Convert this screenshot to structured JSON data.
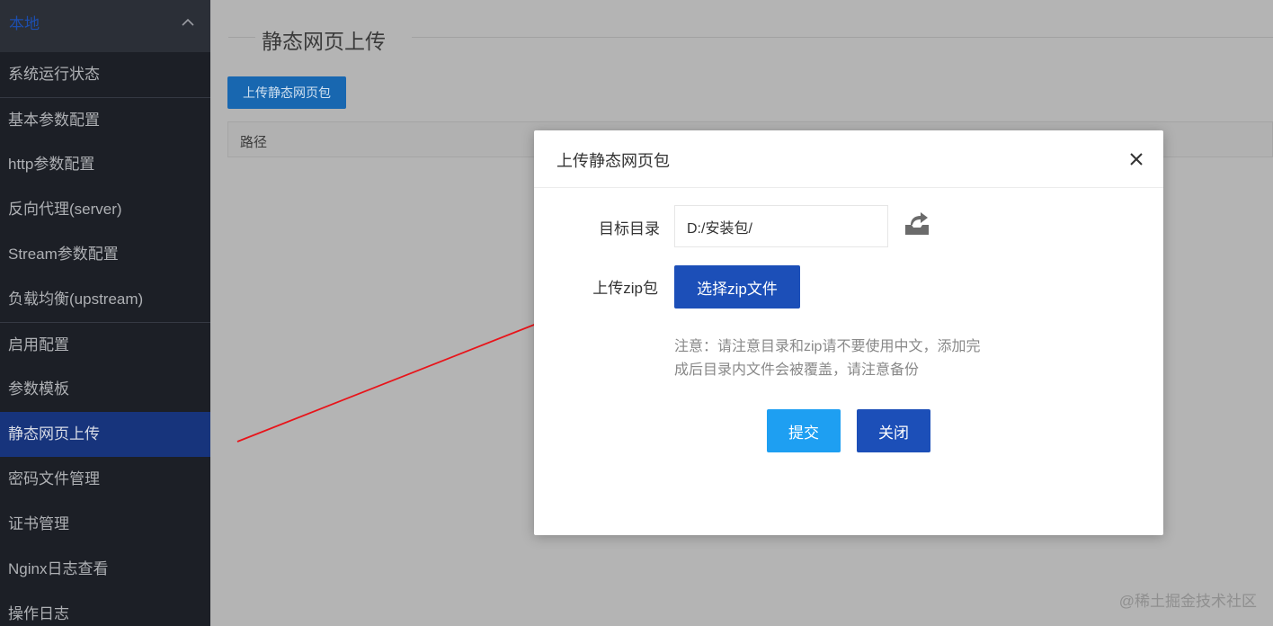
{
  "sidebar": {
    "group_title": "本地",
    "group_icon": "chevron-up-icon",
    "items": [
      {
        "label": "系统运行状态"
      },
      {
        "label": "基本参数配置"
      },
      {
        "label": "http参数配置"
      },
      {
        "label": "反向代理(server)"
      },
      {
        "label": "Stream参数配置"
      },
      {
        "label": "负载均衡(upstream)"
      },
      {
        "label": "启用配置"
      },
      {
        "label": "参数模板"
      },
      {
        "label": "静态网页上传",
        "active": true
      },
      {
        "label": "密码文件管理"
      },
      {
        "label": "证书管理"
      },
      {
        "label": "Nginx日志查看"
      },
      {
        "label": "操作日志"
      }
    ]
  },
  "main": {
    "page_title": "静态网页上传",
    "upload_button": "上传静态网页包",
    "table": {
      "columns": [
        "路径"
      ]
    }
  },
  "modal": {
    "title": "上传静态网页包",
    "close_icon": "close-icon",
    "target_dir_label": "目标目录",
    "target_dir_value": "D:/安装包/",
    "folder_icon": "folder-open-icon",
    "upload_zip_label": "上传zip包",
    "select_zip_button": "选择zip文件",
    "note_line1": "注意：请注意目录和zip请不要使用中文，添加完",
    "note_line2": "成后目录内文件会被覆盖，请注意备份",
    "submit_button": "提交",
    "close_button": "关闭"
  },
  "watermark": "@稀土掘金技术社区",
  "colors": {
    "sidebar_bg": "#1c1f26",
    "active_item_bg": "#17347c",
    "primary_button": "#1c4fb8",
    "submit_button": "#1e9ff2",
    "annotation_arrow": "#e8141a"
  }
}
